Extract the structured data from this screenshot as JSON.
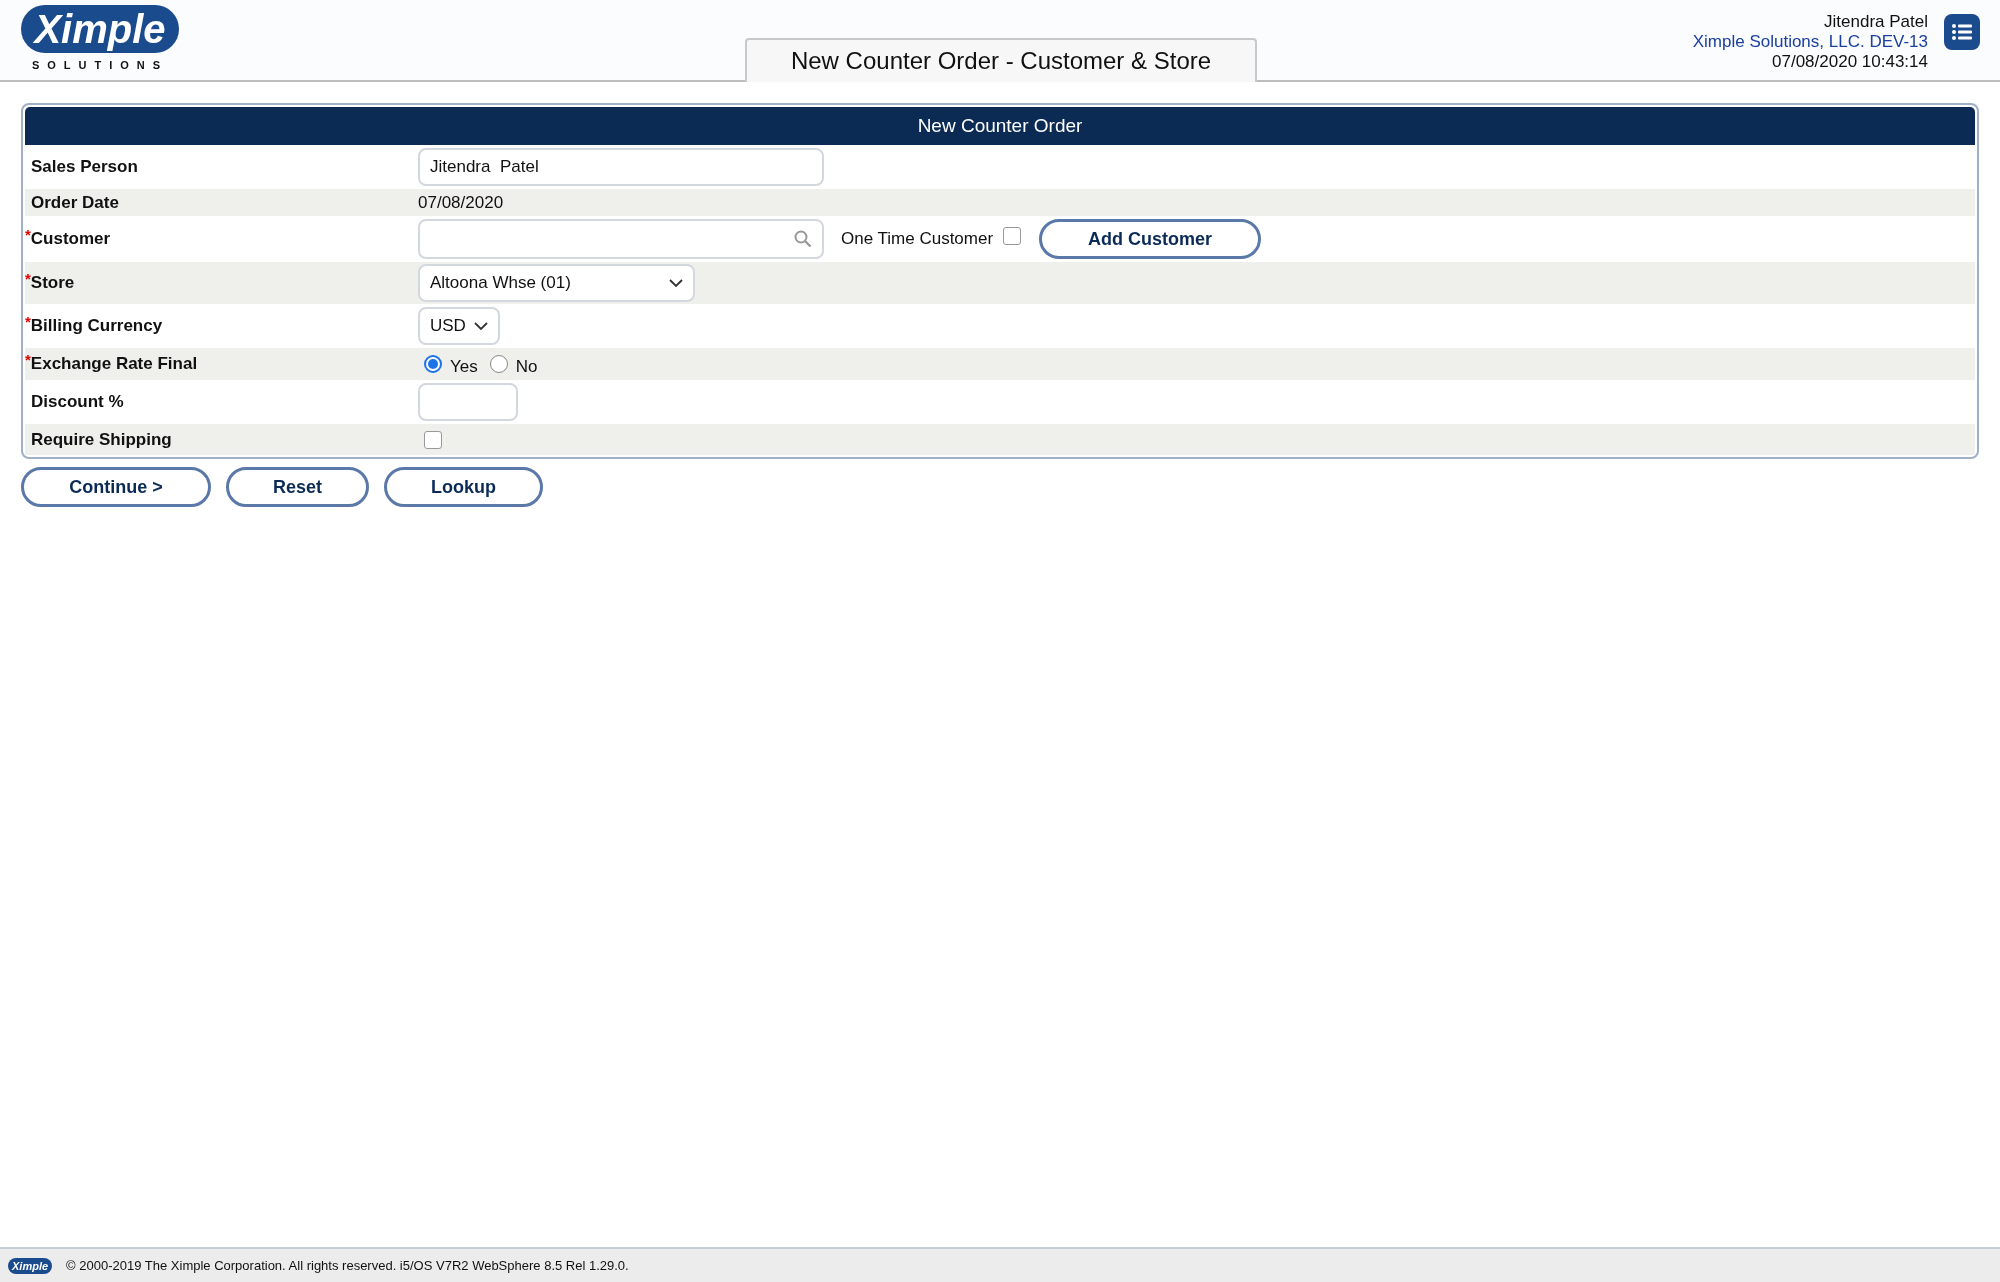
{
  "header": {
    "logo": {
      "wordmark": "Ximple",
      "tagline": "SOLUTIONS"
    },
    "page_tab": "New Counter Order - Customer & Store",
    "user_name": "Jitendra Patel",
    "company": "Ximple Solutions, LLC. DEV-13",
    "datetime": "07/08/2020 10:43:14"
  },
  "form": {
    "title": "New Counter Order",
    "rows": [
      {
        "kind": "input",
        "label": "Sales Person",
        "value": "Jitendra  Patel"
      },
      {
        "kind": "text",
        "label": "Order Date",
        "value": "07/08/2020"
      },
      {
        "kind": "customer",
        "required_mark": "*",
        "label": "Customer",
        "value": "",
        "extra_label": "One Time Customer",
        "checked": false,
        "button": "Add Customer"
      },
      {
        "kind": "select",
        "required_mark": "*",
        "label": "Store",
        "value": "Altoona Whse (01)"
      },
      {
        "kind": "select_small",
        "required_mark": "*",
        "label": "Billing Currency",
        "value": "USD"
      },
      {
        "kind": "radio",
        "required_mark": "*",
        "label": "Exchange Rate Final",
        "options": [
          {
            "label": "Yes",
            "selected": true
          },
          {
            "label": "No",
            "selected": false
          }
        ]
      },
      {
        "kind": "input_small",
        "label": "Discount %",
        "value": ""
      },
      {
        "kind": "checkbox",
        "label": "Require Shipping",
        "checked": false
      }
    ]
  },
  "buttons": [
    "Continue >",
    "Reset",
    "Lookup"
  ],
  "footer": {
    "logo": "Ximple",
    "text": "© 2000-2019 The Ximple Corporation. All rights reserved. i5/OS V7R2 WebSphere 8.5 Rel 1.29.0."
  }
}
